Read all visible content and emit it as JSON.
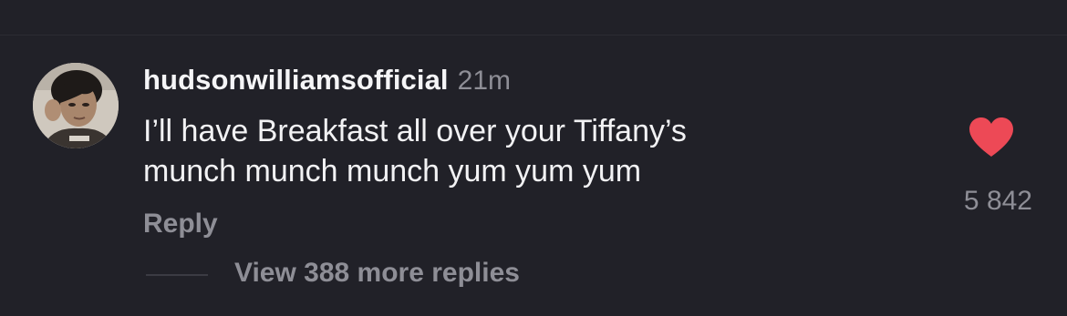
{
  "comment": {
    "username": "hudsonwilliamsofficial",
    "timestamp": "21m",
    "text": "I’ll have Breakfast all over your Tiffany’s\nmunch munch munch yum yum yum",
    "reply_label": "Reply",
    "like_count": "5 842",
    "liked": true,
    "like_color": "#ed4956",
    "view_replies_label": "View 388 more replies",
    "avatar_icon": "profile-photo",
    "like_icon": "heart-icon"
  },
  "colors": {
    "background": "#212128",
    "primary_text": "#f2f2f4",
    "secondary_text": "#8e8e96"
  }
}
